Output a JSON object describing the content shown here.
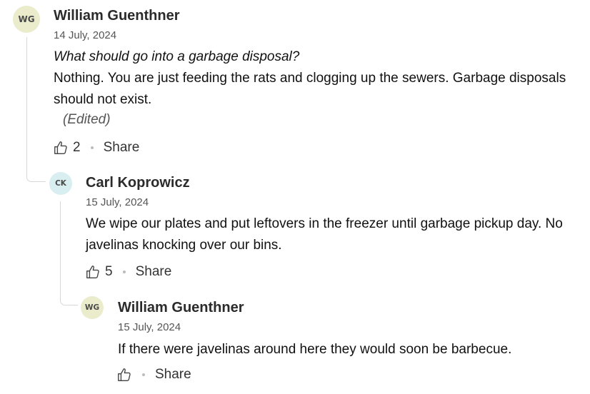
{
  "comments": [
    {
      "initials": "WG",
      "author": "William Guenthner",
      "date": "14 July, 2024",
      "quote": "What should go into a garbage disposal?",
      "body": "Nothing. You are just feeding the rats and clogging up the sewers. Garbage disposals should not exist.",
      "edited": "(Edited)",
      "likes": "2",
      "share_label": "Share",
      "avatar_color": "#eaeccc"
    },
    {
      "initials": "CK",
      "author": "Carl Koprowicz",
      "date": "15 July, 2024",
      "body": "We wipe our plates and put leftovers in the freezer until garbage pickup day. No javelinas knocking over our bins.",
      "likes": "5",
      "share_label": "Share",
      "avatar_color": "#d9eef0"
    },
    {
      "initials": "WG",
      "author": "William Guenthner",
      "date": "15 July, 2024",
      "body": "If there were javelinas around here they would soon be barbecue.",
      "likes": "",
      "share_label": "Share",
      "avatar_color": "#eaeccc"
    }
  ]
}
